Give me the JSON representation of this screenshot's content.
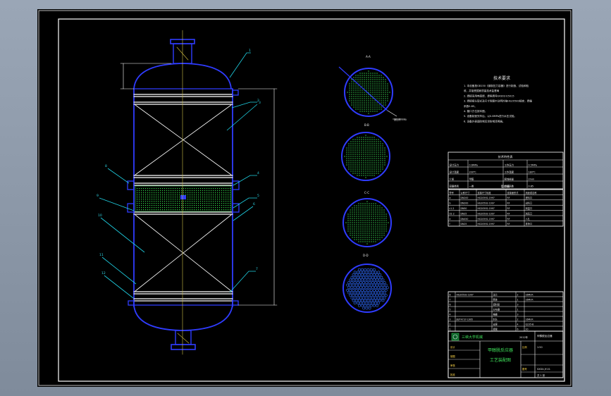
{
  "colors": {
    "sheet_bg": "#000000",
    "viewport_bg": "#8b97a7",
    "vessel": "#2f3cff",
    "leader": "#1fd3e6",
    "frame": "#ffffff",
    "packing": "#35d84a",
    "title_block": "#ffffff"
  },
  "section_labels": [
    "A-A",
    "B-B",
    "C-C",
    "D-D"
  ],
  "detail_label": "按比例 1:50",
  "tech_requirements_title": "技术要求",
  "tech_requirements": [
    "1. 本设备按GB150《钢制压力容器》进行制造、试验和验",
    "收，并接受国家质量技术监督局",
    "2. 焊接采用电弧焊，焊条牌号E4303 E5015",
    "3. 焊接接头型式及尺寸除图中注明外按HG20583规定，焊缝",
    "系数0.85。",
    "4. 管口方位按本图。",
    "5. 设备制造完毕后，以0.8MPa进行水压试验。",
    "6. 设备外表面除锈后涂防锈漆两遍。"
  ],
  "tech_spec_table": {
    "title": "技术特性表",
    "rows": [
      [
        "设计压力",
        "0.6MPa",
        "工作压力",
        "0.5MPa"
      ],
      [
        "设计温度",
        "200℃",
        "工作温度",
        "180℃"
      ],
      [
        "介质",
        "甲醇",
        "腐蚀裕量",
        "2mm"
      ],
      [
        "容器类别",
        "一类",
        "焊缝系数",
        "0.85"
      ]
    ]
  },
  "nozzle_table": {
    "title": "管口表",
    "headers": [
      "符号",
      "公称尺寸",
      "连接尺寸标准",
      "连接面形式",
      "用途或名称"
    ],
    "rows": [
      [
        "a",
        "DN200",
        "HG20592-1997",
        "RF",
        "进料口"
      ],
      [
        "b",
        "DN200",
        "HG20592-1997",
        "RF",
        "出料口"
      ],
      [
        "c1-2",
        "DN50",
        "HG20592-1997",
        "RF",
        "测温口"
      ],
      [
        "d1-2",
        "DN25",
        "HG20592-1997",
        "RF",
        "测压口"
      ],
      [
        "e",
        "DN450",
        "HG20592-1997",
        "RF",
        "人孔"
      ],
      [
        "f",
        "DN25",
        "HG20592-1997",
        "RF",
        "排净口"
      ]
    ]
  },
  "bom_rows": [
    [
      "8",
      "HG20592-1997",
      "法兰",
      "2",
      "16MnR"
    ],
    [
      "7",
      "",
      "筒体",
      "1",
      "16MnR"
    ],
    [
      "6",
      "",
      "填料层",
      "3",
      ""
    ],
    [
      "5",
      "",
      "分布器",
      "1",
      ""
    ],
    [
      "4",
      "",
      "格栅",
      "3",
      ""
    ],
    [
      "3",
      "JB/T4737-1995",
      "封头",
      "2",
      "16MnR"
    ],
    [
      "2",
      "",
      "支座",
      "4",
      "Q235-B"
    ],
    [
      "1",
      "",
      "接管",
      "6",
      "20"
    ]
  ],
  "title_block": {
    "school": "三峡大学机械",
    "year": "2012年",
    "drawing_name_1": "甲醇脱反应器",
    "drawing_name_2": "工艺装配图",
    "scale_label": "比例",
    "scale": "1:50",
    "drawing_no_label": "图号",
    "drawing_no": "SXDX-JY-01",
    "sheet": "共 1 张",
    "roles": [
      "设计",
      "制图",
      "审核",
      "批准"
    ],
    "project": "甲醇脱反应器"
  },
  "leader_numbers": [
    "1",
    "2",
    "3",
    "4",
    "5",
    "6",
    "7",
    "8",
    "9",
    "10",
    "11",
    "12"
  ]
}
